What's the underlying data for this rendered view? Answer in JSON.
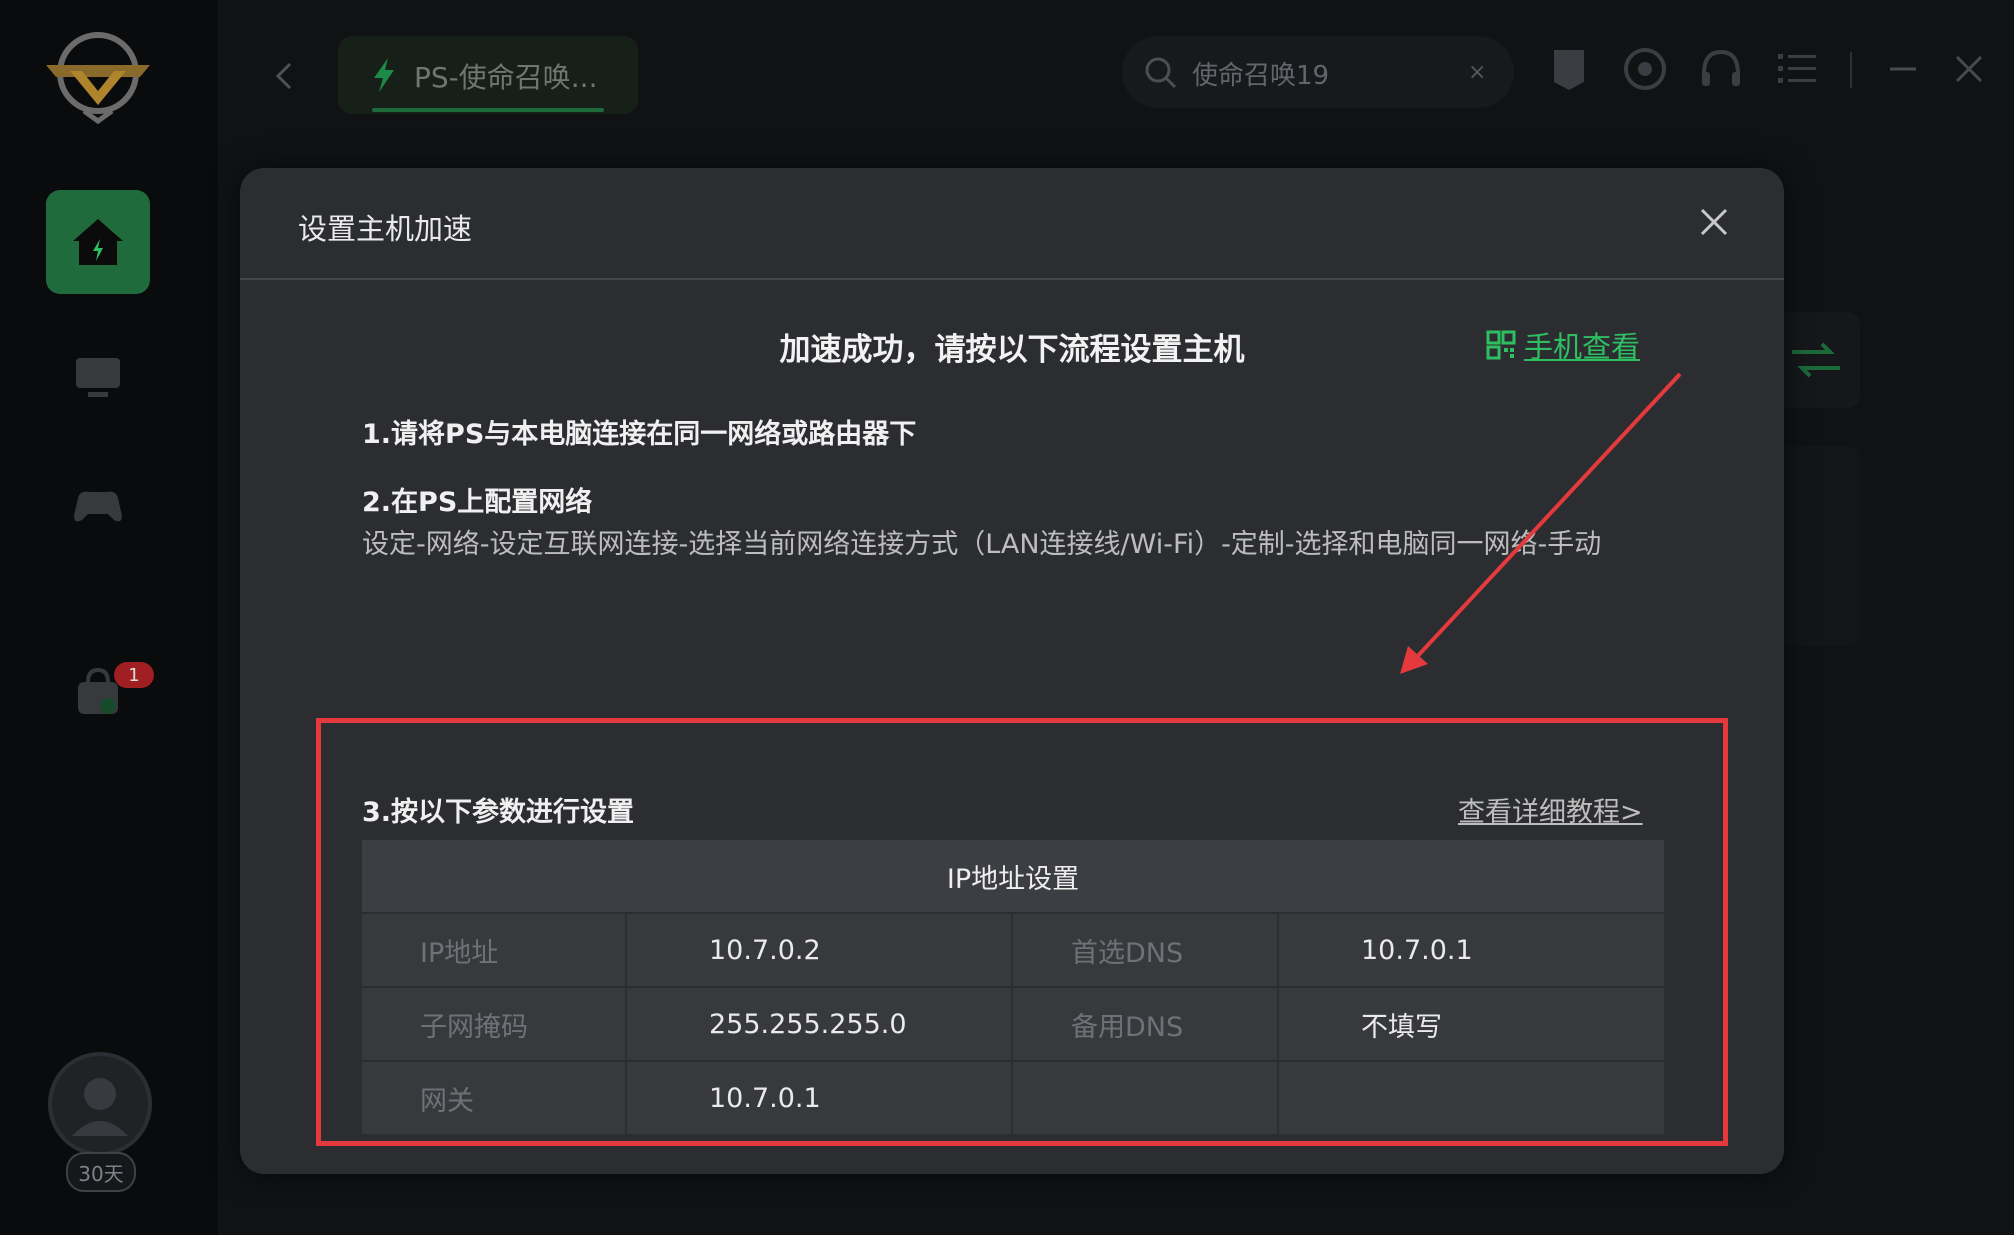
{
  "header": {
    "game_tab_label": "PS-使命召唤...",
    "search_value": "使命召唤19",
    "search_clear": "×"
  },
  "sidebar": {
    "notification_count": "1",
    "membership_days": "30天"
  },
  "modal": {
    "title": "设置主机加速",
    "headline": "加速成功，请按以下流程设置主机",
    "phone_view_label": "手机查看",
    "step1": "1.请将PS与本电脑连接在同一网络或路由器下",
    "step2_title": "2.在PS上配置网络",
    "step2_desc": "设定-网络-设定互联网连接-选择当前网络连接方式（LAN连接线/Wi-Fi）-定制-选择和电脑同一网络-手动",
    "step3_title": "3.按以下参数进行设置",
    "tutorial_link": "查看详细教程>",
    "table": {
      "header": "IP地址设置",
      "rows": [
        {
          "label1": "IP地址",
          "value1": "10.7.0.2",
          "label2": "首选DNS",
          "value2": "10.7.0.1"
        },
        {
          "label1": "子网掩码",
          "value1": "255.255.255.0",
          "label2": "备用DNS",
          "value2": "不填写"
        },
        {
          "label1": "网关",
          "value1": "10.7.0.1",
          "label2": "",
          "value2": ""
        }
      ]
    }
  },
  "colors": {
    "accent_green": "#2fbf63",
    "highlight_red": "#e43a3d",
    "modal_bg": "#2b2d31"
  },
  "icons": [
    "logo-icon",
    "home-icon",
    "monitor-icon",
    "gamepad-icon",
    "bag-icon",
    "back-icon",
    "bolt-icon",
    "search-icon",
    "epic-icon",
    "steam-icon",
    "headset-icon",
    "list-icon",
    "minimize-icon",
    "close-icon",
    "qr-code-icon",
    "swap-icon"
  ]
}
